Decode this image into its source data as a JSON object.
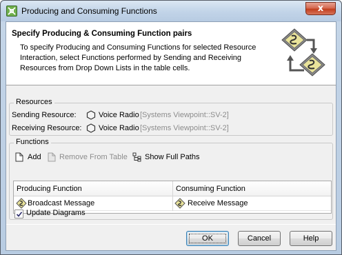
{
  "window": {
    "title": "Producing and Consuming Functions",
    "close_glyph": "x"
  },
  "header": {
    "title": "Specify Producing & Consuming Function pairs",
    "description": "To specify Producing and Consuming Functions for selected Resource Interaction, select Functions performed by Sending and Receiving Resources from Drop Down Lists in the table cells.",
    "graphic_icon": "function-flow-icon"
  },
  "resources": {
    "group_label": "Resources",
    "sending": {
      "label": "Sending Resource:",
      "name": "Voice Radio",
      "path": "[Systems Viewpoint::SV-2]"
    },
    "receiving": {
      "label": "Receiving Resource:",
      "name": "Voice Radio",
      "path": "[Systems Viewpoint::SV-2]"
    }
  },
  "functions": {
    "group_label": "Functions",
    "toolbar": {
      "add_label": "Add",
      "remove_label": "Remove From Table",
      "show_paths_label": "Show Full Paths"
    },
    "table": {
      "columns": [
        "Producing Function",
        "Consuming Function"
      ],
      "rows": [
        {
          "producing": "Broadcast Message",
          "consuming": "Receive Message"
        }
      ]
    }
  },
  "options": {
    "update_diagrams_label": "Update Diagrams",
    "update_diagrams_checked": true
  },
  "buttons": {
    "ok": "OK",
    "cancel": "Cancel",
    "help": "Help"
  },
  "colors": {
    "title_bar": "#c3d5e9",
    "close_button": "#c2401f",
    "path_text": "#8c8c8c",
    "default_button_border": "#3c7fb1"
  }
}
